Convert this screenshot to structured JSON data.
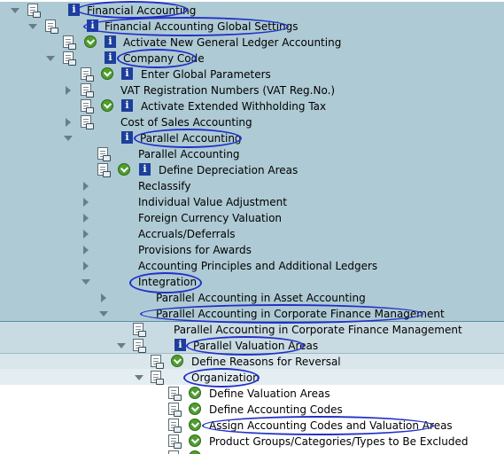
{
  "rows": [
    {
      "id": "r0",
      "label": "Financial Accounting"
    },
    {
      "id": "r1",
      "label": "Financial Accounting Global Settings"
    },
    {
      "id": "r2",
      "label": "Activate New General Ledger Accounting"
    },
    {
      "id": "r3",
      "label": "Company Code"
    },
    {
      "id": "r4",
      "label": "Enter Global Parameters"
    },
    {
      "id": "r5",
      "label": "VAT Registration Numbers (VAT Reg.No.)"
    },
    {
      "id": "r6",
      "label": "Activate Extended Withholding Tax"
    },
    {
      "id": "r7",
      "label": "Cost of Sales Accounting"
    },
    {
      "id": "r8",
      "label": "Parallel Accounting"
    },
    {
      "id": "r9",
      "label": "Parallel Accounting"
    },
    {
      "id": "r10",
      "label": "Define Depreciation Areas"
    },
    {
      "id": "r11",
      "label": "Reclassify"
    },
    {
      "id": "r12",
      "label": "Individual Value Adjustment"
    },
    {
      "id": "r13",
      "label": "Foreign Currency Valuation"
    },
    {
      "id": "r14",
      "label": "Accruals/Deferrals"
    },
    {
      "id": "r15",
      "label": "Provisions for Awards"
    },
    {
      "id": "r16",
      "label": "Accounting Principles and Additional Ledgers"
    },
    {
      "id": "r17",
      "label": "Integration"
    },
    {
      "id": "r18",
      "label": "Parallel Accounting in Asset Accounting"
    },
    {
      "id": "r19",
      "label": "Parallel Accounting in Corporate Finance Management"
    },
    {
      "id": "r20",
      "label": "Parallel Accounting in Corporate Finance Management"
    },
    {
      "id": "r21",
      "label": "Parallel Valuation Areas"
    },
    {
      "id": "r22",
      "label": "Define Reasons for Reversal"
    },
    {
      "id": "r23",
      "label": "Organization"
    },
    {
      "id": "r24",
      "label": "Define Valuation Areas"
    },
    {
      "id": "r25",
      "label": "Define Accounting Codes"
    },
    {
      "id": "r26",
      "label": "Assign Accounting Codes and Valuation Areas"
    },
    {
      "id": "r27",
      "label": "Product Groups/Categories/Types to Be Excluded"
    }
  ],
  "icons": {
    "expand_open": "triangle-down-icon",
    "expand_closed": "triangle-right-icon",
    "node": "document-icon",
    "execute": "execute-clock-icon",
    "info": "information-icon"
  },
  "colors": {
    "band_dark": "#aecad4",
    "band_mid": "#c9dbe2",
    "band_light": "#e4eef2",
    "annotation_oval": "#2230c8",
    "info_icon": "#1d3f9b",
    "execute_icon": "#4f9e2f"
  }
}
